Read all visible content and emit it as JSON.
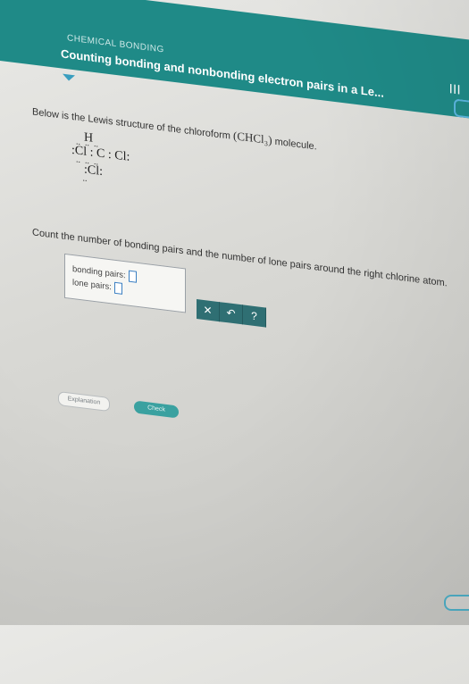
{
  "header": {
    "category": "CHEMICAL BONDING",
    "title": "Counting bonding and nonbonding electron pairs in a Le..."
  },
  "problem": {
    "intro_prefix": "Below is the Lewis structure of the chloroform",
    "formula": "(CHCl₃)",
    "intro_suffix": "molecule.",
    "lewis_rows": [
      "    H",
      "  ..  ..  ..",
      ":Cl : C : Cl:",
      "  ..  ..  ..",
      "    :Cl:",
      "     .."
    ],
    "question": "Count the number of bonding pairs and the number of lone pairs around the right chlorine atom."
  },
  "answer": {
    "bonding_label": "bonding pairs:",
    "lone_label": "lone pairs:"
  },
  "buttons": {
    "clear": "✕",
    "undo": "↶",
    "help": "?"
  },
  "footer": {
    "explanation": "Explanation",
    "check": "Check"
  },
  "colors": {
    "topbar": "#1f8a87",
    "button": "#2f6f73",
    "check": "#3aa1a0"
  }
}
